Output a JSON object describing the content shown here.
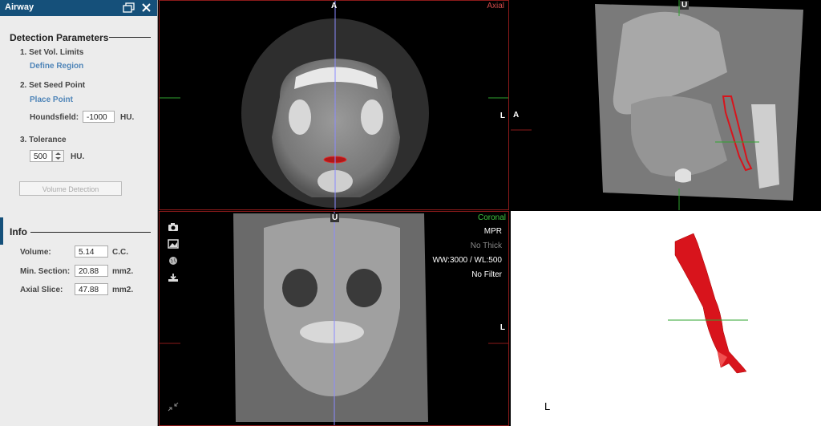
{
  "panel": {
    "title": "Airway",
    "detection": {
      "heading": "Detection Parameters",
      "step1": "1. Set Vol. Limits",
      "define_region": "Define Region",
      "step2": "2. Set Seed Point",
      "place_point": "Place Point",
      "houndsfield_label": "Houndsfield:",
      "houndsfield_value": "-1000",
      "houndsfield_unit": "HU.",
      "step3": "3. Tolerance",
      "tolerance_value": "500",
      "tolerance_unit": "HU.",
      "volume_button": "Volume Detection"
    },
    "info": {
      "heading": "Info",
      "rows": [
        {
          "label": "Volume:",
          "value": "5.14",
          "unit": "C.C."
        },
        {
          "label": "Min. Section:",
          "value": "20.88",
          "unit": "mm2."
        },
        {
          "label": "Axial Slice:",
          "value": "47.88",
          "unit": "mm2."
        }
      ]
    }
  },
  "viewports": {
    "axial": {
      "name": "Axial",
      "top_marker": "A",
      "right_marker": "L"
    },
    "sagittal": {
      "top_marker": "U",
      "left_marker": "A"
    },
    "coronal": {
      "name": "Coronal",
      "top_marker": "U",
      "right_marker": "L",
      "overlay": [
        "MPR",
        "No Thick",
        "WW:3000 / WL:500",
        "No Filter"
      ]
    },
    "volume3d": {
      "corner_marker": "L"
    }
  },
  "colors": {
    "accent": "#15507a",
    "link": "#4f85b8",
    "axial_label": "#d04a4a",
    "coronal_label": "#3fc63f",
    "airway_red": "#d8141c",
    "crosshair_green": "#2fa52f"
  }
}
